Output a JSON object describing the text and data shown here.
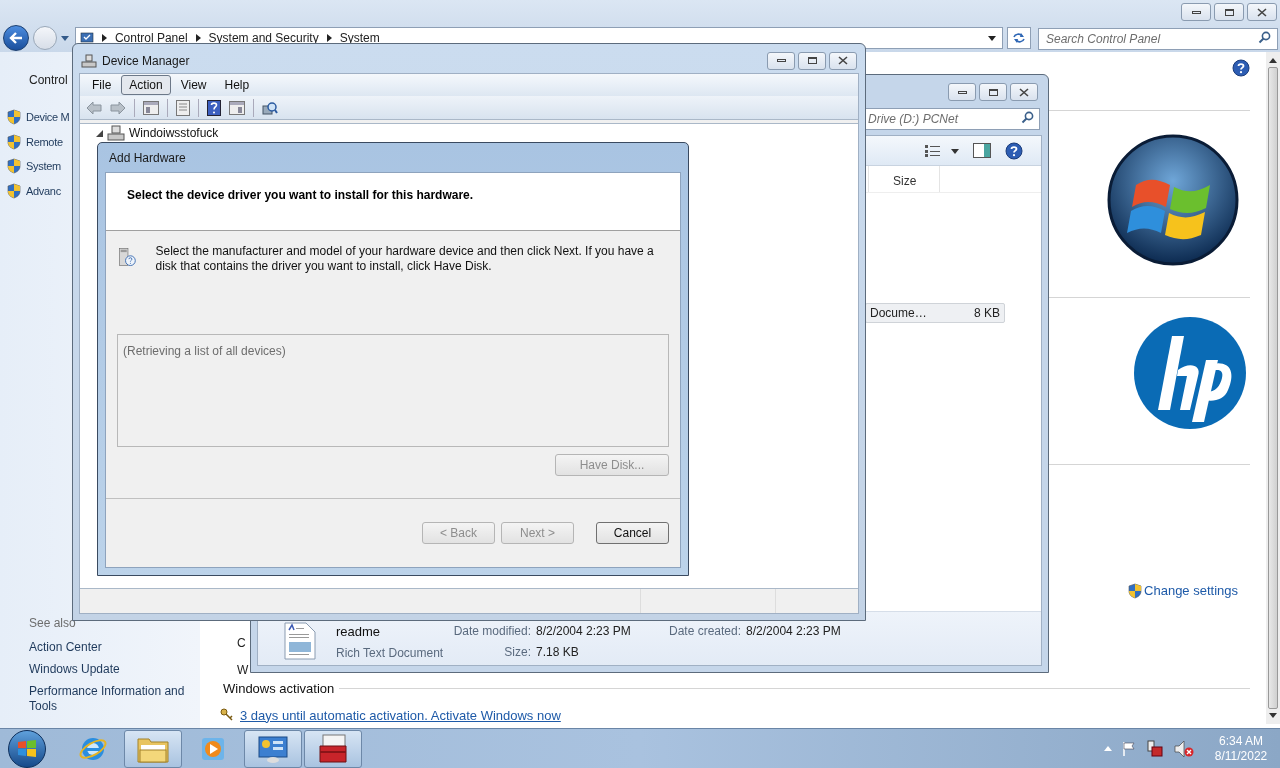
{
  "control_panel": {
    "breadcrumb": [
      "Control Panel",
      "System and Security",
      "System"
    ],
    "search": {
      "placeholder": "Search Control Panel"
    },
    "sidebar": {
      "home": "Control",
      "tasks": [
        "Device M",
        "Remote",
        "System",
        "Advanc"
      ],
      "see_also_heading": "See also",
      "see_also": [
        "Action Center",
        "Windows Update",
        "Performance Information and Tools"
      ]
    },
    "fragments": [
      "C",
      "W"
    ],
    "change_settings": "Change settings",
    "activation": {
      "heading": "Windows activation",
      "link": "3 days until automatic activation. Activate Windows now"
    }
  },
  "explorer": {
    "search": {
      "placeholder": "Drive (D:) PCNet"
    },
    "columns": [
      "Size"
    ],
    "rows": [
      {
        "name": "Docume…",
        "size": "8 KB",
        "selected": true
      }
    ],
    "details": {
      "name": "readme",
      "type": "Rich Text Document",
      "columns": [
        [
          {
            "label": "Date modified:",
            "value": "8/2/2004 2:23 PM"
          },
          {
            "label": "Size:",
            "value": "7.18 KB"
          }
        ],
        [
          {
            "label": "Date created:",
            "value": "8/2/2004 2:23 PM"
          }
        ]
      ]
    }
  },
  "device_manager": {
    "title": "Device Manager",
    "menu": [
      {
        "label": "File",
        "selected": false
      },
      {
        "label": "Action",
        "selected": true
      },
      {
        "label": "View",
        "selected": false
      },
      {
        "label": "Help",
        "selected": false
      }
    ],
    "tree": {
      "label": "Windoiwsstofuck",
      "expanded": true
    }
  },
  "dialog": {
    "title": "Add Hardware",
    "heading": "Select the device driver you want to install for this hardware.",
    "description": "Select the manufacturer and model of your hardware device and then click Next. If you have a disk that contains the driver you want to install, click Have Disk.",
    "list_status": "(Retrieving a list of all devices)",
    "have_disk": {
      "label": "Have Disk...",
      "disabled": true
    },
    "buttons": [
      {
        "label": "< Back",
        "disabled": true
      },
      {
        "label": "Next >",
        "disabled": true
      },
      {
        "label": "Cancel",
        "disabled": false
      }
    ]
  },
  "taskbar": {
    "apps": [
      {
        "kind": "ie",
        "active": false
      },
      {
        "kind": "explorer",
        "active": true
      },
      {
        "kind": "media",
        "active": false
      },
      {
        "kind": "control",
        "active": true
      },
      {
        "kind": "toolbox",
        "active": true
      }
    ],
    "clock": {
      "time": "6:34 AM",
      "date": "8/11/2022"
    }
  }
}
